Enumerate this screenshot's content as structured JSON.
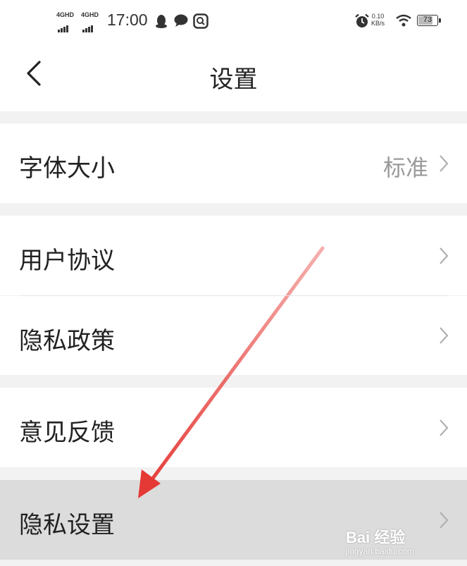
{
  "status_bar": {
    "signal_1_label": "4GHD",
    "signal_2_label": "4GHD",
    "time": "17:00",
    "net_speed_value": "0.10",
    "net_speed_unit": "KB/s",
    "battery_level": "73",
    "icons": [
      "qq-penguin-icon",
      "chat-bubble-icon",
      "app-notification-icon",
      "alarm-clock-icon",
      "wifi-icon",
      "battery-icon"
    ]
  },
  "header": {
    "title": "设置",
    "back_icon": "chevron-left-icon"
  },
  "settings": {
    "font_size_label": "字体大小",
    "font_size_value": "标准",
    "user_agreement_label": "用户协议",
    "privacy_policy_label": "隐私政策",
    "feedback_label": "意见反馈",
    "privacy_settings_label": "隐私设置"
  },
  "annotation": {
    "arrow_color": "#e53935",
    "points_to": "隐私设置"
  },
  "watermark": {
    "text": "Bai 经验",
    "sub": "jingyan.baidu.com"
  },
  "colors": {
    "background": "#f2f2f2",
    "row": "#ffffff",
    "highlight": "#dcdcdc",
    "text": "#222222",
    "secondary_text": "#9a9a9a"
  }
}
